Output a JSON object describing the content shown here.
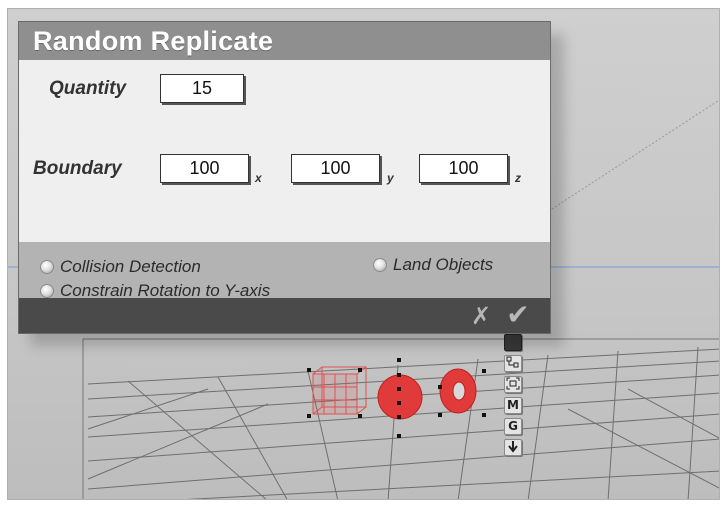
{
  "dialog": {
    "title": "Random Replicate",
    "quantity": {
      "label": "Quantity",
      "value": "15"
    },
    "boundary": {
      "label": "Boundary",
      "x": {
        "value": "100",
        "axis": "x"
      },
      "y": {
        "value": "100",
        "axis": "y"
      },
      "z": {
        "value": "100",
        "axis": "z"
      }
    },
    "options": [
      {
        "label": "Collision Detection",
        "checked": false
      },
      {
        "label": "Constrain Rotation to Y-axis",
        "checked": false
      },
      {
        "label": "Land Objects",
        "checked": false
      }
    ],
    "cancel_icon": "x-icon",
    "ok_icon": "check-icon"
  },
  "viewport_tools": [
    {
      "label": "",
      "icon": "solid-square-icon"
    },
    {
      "label": "",
      "icon": "hierarchy-icon"
    },
    {
      "label": "",
      "icon": "frame-object-icon"
    },
    {
      "label": "M",
      "icon": "material-icon"
    },
    {
      "label": "G",
      "icon": "group-icon"
    },
    {
      "label": "",
      "icon": "drop-to-floor-icon"
    }
  ],
  "colors": {
    "viewport_bg": "#c8c8c8",
    "object_red": "#e03a3a",
    "dialog_title_bg": "#8f8f8f",
    "dialog_footer_bg": "#4a4a4a",
    "horizon_line": "#7a9ad6"
  }
}
